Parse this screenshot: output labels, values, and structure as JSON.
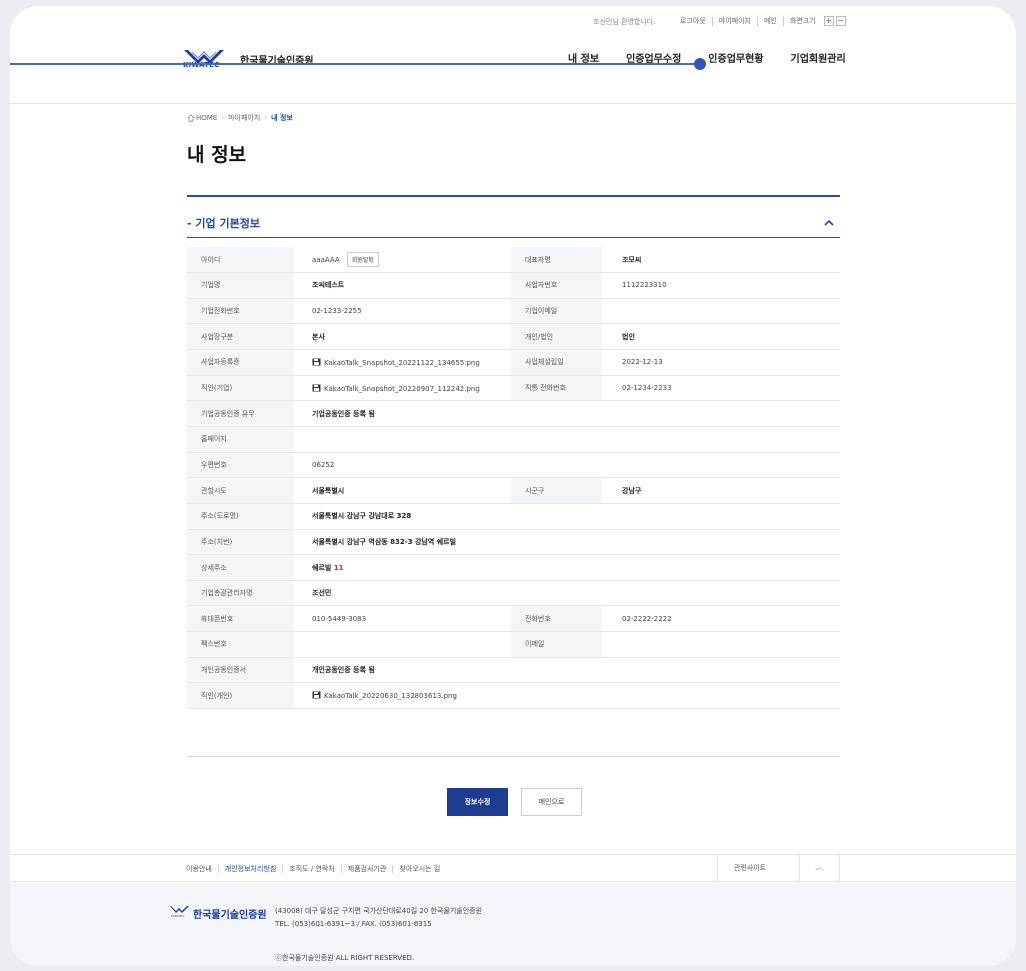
{
  "topbar": {
    "welcome": "조선민님 환영합니다.",
    "links": [
      "로그아웃",
      "마이페이지",
      "메인",
      "화면크기"
    ],
    "zoom_in": "+",
    "zoom_out": "−"
  },
  "header": {
    "logo_name": "한국물기술인증원",
    "logo_sub": "KIWATEC",
    "nav": [
      "내 정보",
      "인증업무수정",
      "인증업무현황",
      "기업회원관리"
    ]
  },
  "breadcrumb": {
    "home": "HOME",
    "mypage": "마이페이지",
    "current": "내 정보"
  },
  "page_title": "내 정보",
  "section": {
    "title": "- 기업 기본정보"
  },
  "info": {
    "id_label": "아이디",
    "id_value": "aaaAAA",
    "withdraw_btn": "회원탈퇴",
    "ceo_label": "대표자명",
    "ceo_value": "조모씨",
    "company_label": "기업명",
    "company_value": "조씨테스트",
    "bizno_label": "사업자번호",
    "bizno_value": "1112223310",
    "tel_label": "기업전화번호",
    "tel_value": "02-1233-2255",
    "email_label": "기업이메일",
    "email_value": "",
    "biztype_label": "사업장구분",
    "biztype_value": "본사",
    "person_label": "개인/법인",
    "person_value": "법인",
    "bizcert_label": "사업자등록증",
    "bizcert_file": "KakaoTalk_Snapshot_20221122_134655.png",
    "founded_label": "사업체설립일",
    "founded_value": "2022-12-13",
    "seal_label": "직인(기업)",
    "seal_file": "KakaoTalk_Snapshot_20220907_112242.png",
    "direct_label": "직통 전화번호",
    "direct_value": "02-1234-2233",
    "cert_label": "기업공동인증 유무",
    "cert_value": "기업공동인증 등록 됨",
    "homepage_label": "홈페이지",
    "homepage_value": "",
    "zip_label": "우편번호",
    "zip_value": "06252",
    "sido_label": "관할시도",
    "sido_value": "서울특별시",
    "sigungu_label": "시군구",
    "sigungu_value": "강남구",
    "road_label": "주소(도로명)",
    "road_value": "서울특별시 강남구 강남대로 328",
    "jibun_label": "주소(지번)",
    "jibun_value": "서울특별시 강남구 역삼동 832-3 강남역 쉐르빌",
    "detail_label": "상세주소",
    "detail_value_a": "쉐르빌 ",
    "detail_value_b": "11",
    "manager_label": "기업총괄관리자명",
    "manager_value": "조선민",
    "mobile_label": "휴대폰번호",
    "mobile_value": "010-5449-3083",
    "phone_label": "전화번호",
    "phone_value": "02-2222-2222",
    "fax_label": "팩스번호",
    "fax_value": "",
    "mail_label": "이메일",
    "mail_value": "",
    "pcert_label": "개인공동인증서",
    "pcert_value": "개인공동인증 등록 됨",
    "pseal_label": "직인(개인)",
    "pseal_file": "KakaoTalk_20220630_132803613.png"
  },
  "buttons": {
    "edit": "정보수정",
    "main": "메인으로"
  },
  "footer_nav": {
    "links": [
      "이용안내",
      "개인정보처리방침",
      "조직도 / 연락처",
      "제품검사기관",
      "찾아오시는 길"
    ],
    "related": "관련사이트",
    "top": "︿"
  },
  "footer": {
    "name": "한국물기술인증원",
    "address": "(43008) 대구 달성군 구지면 국가산단대로40길 20 한국물기술인증원",
    "tel": "TEL. (053)601-6391~3 / FAX. (053)601-6315",
    "copy": "ⓒ한국물기술인증원 ALL RIGHT RESERVED."
  },
  "colors": {
    "brand": "#1e3c8f",
    "accent": "#1e4aa6",
    "callout": "#4a6ab3"
  }
}
